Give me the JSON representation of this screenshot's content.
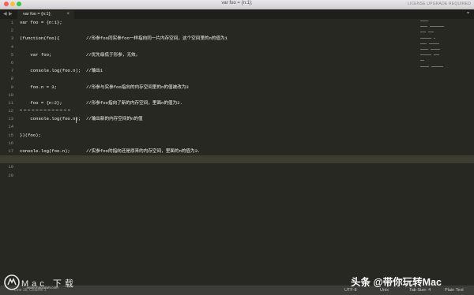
{
  "window": {
    "title": "var foo = {n:1};",
    "license": "LICENSE UPGRADE REQUIRED"
  },
  "tabbar": {
    "nav_back": "◀",
    "nav_forward": "▶",
    "tab_title": "var foo = {n:1};",
    "tab_close": "×",
    "dropdown": "▾"
  },
  "editor": {
    "line_numbers": [
      "1",
      "2",
      "3",
      "4",
      "5",
      "6",
      "7",
      "8",
      "9",
      "10",
      "11",
      "12",
      "13",
      "14",
      "15",
      "16",
      "17",
      "18",
      "19",
      "20"
    ],
    "lines": [
      {
        "code": "var foo = {n:1};",
        "comment": ""
      },
      {
        "code": "",
        "comment": ""
      },
      {
        "code": "(function(foo){",
        "comment": "//形参foo同实参foo一样指向同一片内存空间，这个空间里的n的值为1"
      },
      {
        "code": "",
        "comment": ""
      },
      {
        "code": "    var foo;",
        "comment": "//优先级低于形参，无效。"
      },
      {
        "code": "",
        "comment": ""
      },
      {
        "code": "    console.log(foo.n);",
        "comment": "//输出1"
      },
      {
        "code": "",
        "comment": ""
      },
      {
        "code": "    foo.n = 3;",
        "comment": "//形参与实参foo指向的内存空间里的n的值被改为3"
      },
      {
        "code": "",
        "comment": ""
      },
      {
        "code": "    foo = {n:2};",
        "comment": "//形参foo指向了新的内存空间，里面n的值为2."
      },
      {
        "code": "",
        "comment": ""
      },
      {
        "code": "    console.log(foo.n);",
        "comment": "//输出新的内存空间的n的值"
      },
      {
        "code": "",
        "comment": ""
      },
      {
        "code": "})(foo);",
        "comment": ""
      },
      {
        "code": "",
        "comment": ""
      },
      {
        "code": "console.log(foo.n);",
        "comment": "//实参foo的指向还是原来的内存空间，里面的n的值为3."
      },
      {
        "code": "",
        "comment": ""
      },
      {
        "code": "",
        "comment": ""
      },
      {
        "code": "",
        "comment": ""
      }
    ],
    "current_line": 18
  },
  "statusbar": {
    "left": "Line 18, Column 1",
    "encoding": "UTF-8",
    "line_endings": "Unix",
    "tab_size": "Tab Size: 4",
    "syntax": "Plain Text"
  },
  "watermark_left": {
    "logo_text": "Mac 下载",
    "site": "www.macdown.com"
  },
  "watermark_right": "头条 @带你玩转Mac",
  "colors": {
    "editor_bg": "#272822",
    "text": "#f8f8f2",
    "gutter_text": "#90908a",
    "status_bg": "#3c3d38"
  }
}
